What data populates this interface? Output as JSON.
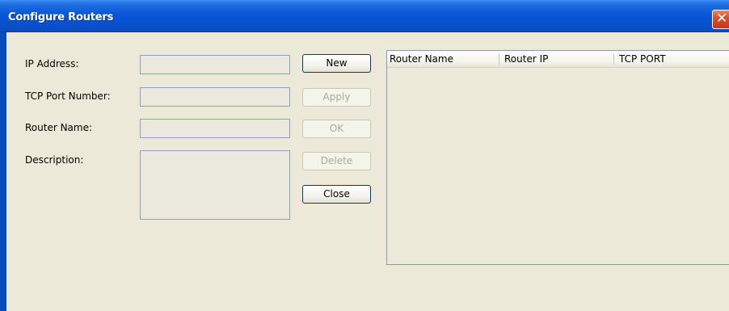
{
  "window": {
    "title": "Configure Routers",
    "close_glyph": "✕"
  },
  "form": {
    "ip_address_label": "IP Address:",
    "ip_address_value": "",
    "tcp_port_label": "TCP Port Number:",
    "tcp_port_value": "",
    "router_name_label": "Router Name:",
    "router_name_value": "",
    "description_label": "Description:",
    "description_value": ""
  },
  "buttons": {
    "new": "New",
    "apply": "Apply",
    "ok": "OK",
    "delete": "Delete",
    "close": "Close"
  },
  "router_list": {
    "columns": [
      "Router Name",
      "Router IP",
      "TCP PORT"
    ],
    "rows": []
  },
  "icons": {
    "close": "close-icon"
  },
  "colors": {
    "title_bar": "#0a56d8",
    "close_button": "#d9512c",
    "dialog_background": "#ece9d8"
  }
}
